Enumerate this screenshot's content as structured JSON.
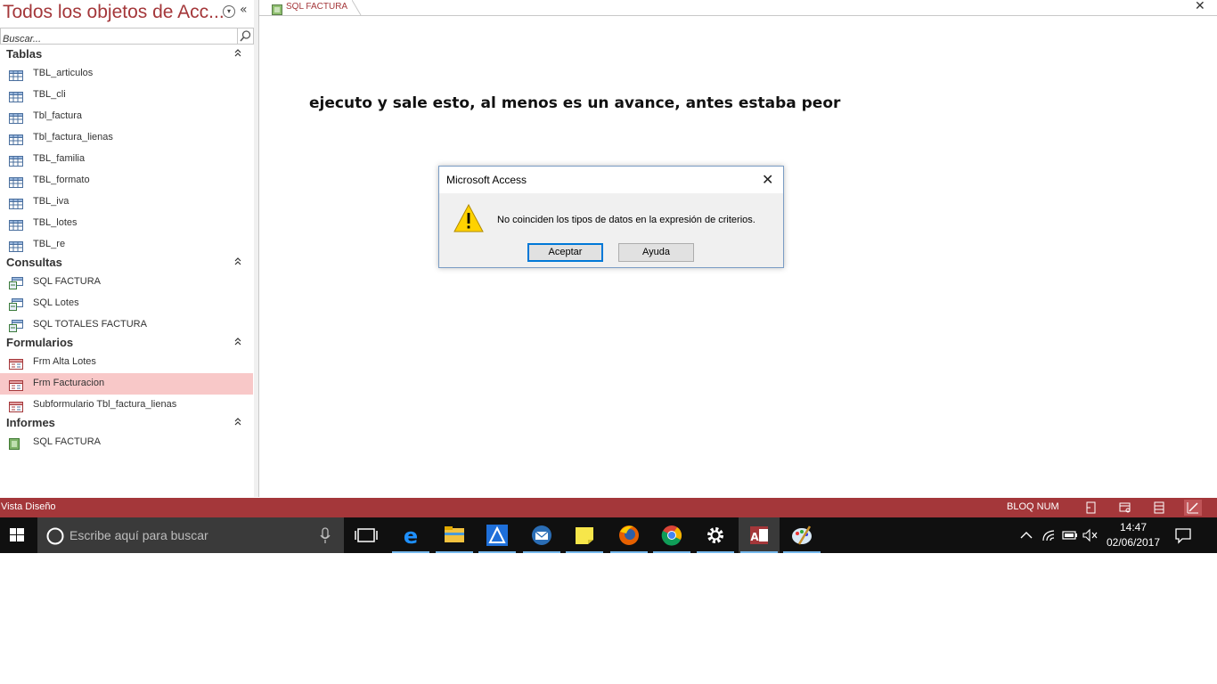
{
  "nav": {
    "title": "Todos los objetos de Acc...",
    "search_placeholder": "Buscar...",
    "groups": [
      {
        "label": "Tablas",
        "items": [
          "TBL_articulos",
          "TBL_cli",
          "Tbl_factura",
          "Tbl_factura_lienas",
          "TBL_familia",
          "TBL_formato",
          "TBL_iva",
          "TBL_lotes",
          "TBL_re"
        ]
      },
      {
        "label": "Consultas",
        "items": [
          "SQL FACTURA",
          "SQL Lotes",
          "SQL TOTALES FACTURA"
        ]
      },
      {
        "label": "Formularios",
        "items": [
          "Frm Alta Lotes",
          "Frm Facturacion",
          "Subformulario Tbl_factura_lienas"
        ]
      },
      {
        "label": "Informes",
        "items": [
          "SQL FACTURA"
        ]
      }
    ],
    "selected_item": "Frm Facturacion"
  },
  "document": {
    "tab_label": "SQL FACTURA",
    "annotation": "ejecuto y sale esto, al menos es un avance, antes estaba peor"
  },
  "dialog": {
    "title": "Microsoft Access",
    "message": "No coinciden los tipos de datos en la expresión de criterios.",
    "ok_label": "Aceptar",
    "help_label": "Ayuda"
  },
  "statusbar": {
    "text": "Vista Diseño",
    "numlock": "BLOQ NUM"
  },
  "taskbar": {
    "search_placeholder": "Escribe aquí para buscar",
    "time": "14:47",
    "date": "02/06/2017"
  },
  "colors": {
    "access_accent": "#a4373a",
    "selected_item": "#f8c8c8",
    "taskbar": "#101010",
    "taskbar_underline": "#76b9ed"
  }
}
